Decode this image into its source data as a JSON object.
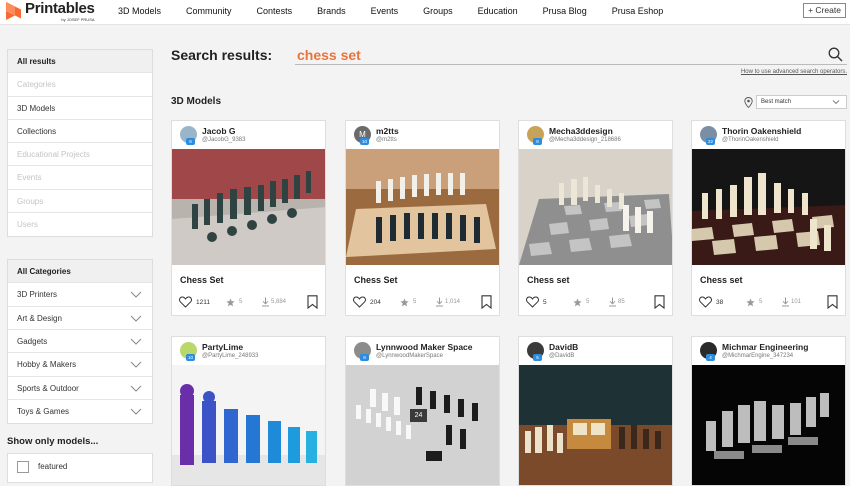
{
  "header": {
    "logo_name": "Printables",
    "logo_sub": "by JOSEF PRUSA",
    "nav": [
      "3D Models",
      "Community",
      "Contests",
      "Brands",
      "Events",
      "Groups",
      "Education",
      "Prusa Blog",
      "Prusa Eshop"
    ],
    "create_label": "+ Create"
  },
  "sidebar": {
    "results": [
      {
        "label": "All results",
        "state": "active"
      },
      {
        "label": "Categories",
        "state": "disabled"
      },
      {
        "label": "3D Models",
        "state": "normal"
      },
      {
        "label": "Collections",
        "state": "normal"
      },
      {
        "label": "Educational Projects",
        "state": "disabled"
      },
      {
        "label": "Events",
        "state": "disabled"
      },
      {
        "label": "Groups",
        "state": "disabled"
      },
      {
        "label": "Users",
        "state": "disabled"
      }
    ],
    "categories_title": "All Categories",
    "categories": [
      "3D Printers",
      "Art & Design",
      "Gadgets",
      "Hobby & Makers",
      "Sports & Outdoor",
      "Toys & Games"
    ],
    "show_only_title": "Show only models...",
    "featured_label": "featured"
  },
  "search": {
    "label": "Search results:",
    "query": "chess set",
    "advanced_link": "How to use advanced search operators."
  },
  "results": {
    "section_title": "3D Models",
    "sort_value": "Best match",
    "models": [
      {
        "author": "Jacob G",
        "handle": "@JacobG_9383",
        "level": "8",
        "avatar": "#9ab4c9",
        "title": "Chess Set",
        "likes": "1211",
        "rating": "5",
        "downloads": "5,884",
        "thumb": "glass"
      },
      {
        "author": "m2tts",
        "handle": "@m2tts",
        "level": "10",
        "avatar": "#6b6b6b",
        "avatar_letter": "M",
        "title": "Chess Set",
        "likes": "204",
        "rating": "5",
        "downloads": "1,014",
        "thumb": "wood"
      },
      {
        "author": "Mecha3ddesign",
        "handle": "@Mecha3ddesign_218686",
        "level": "8",
        "avatar": "#c7a35a",
        "title": "Chess set",
        "likes": "5",
        "rating": "5",
        "downloads": "85",
        "thumb": "grey"
      },
      {
        "author": "Thorin Oakenshield",
        "handle": "@ThorinOakenshield",
        "level": "22",
        "avatar": "#7a8fa3",
        "title": "Chess set",
        "likes": "38",
        "rating": "5",
        "downloads": "101",
        "thumb": "dark"
      },
      {
        "author": "PartyLime",
        "handle": "@PartyLime_248933",
        "level": "10",
        "avatar": "#b9d86a",
        "thumb": "blue"
      },
      {
        "author": "Lynnwood Maker Space",
        "handle": "@LynnwoodMakerSpace",
        "level": "8",
        "avatar": "#8c8c8c",
        "thumb": "bw",
        "image_count": "24"
      },
      {
        "author": "DavidB",
        "handle": "@DavidB",
        "level": "5",
        "avatar": "#3b3b3b",
        "thumb": "clock"
      },
      {
        "author": "Michmar Engineering",
        "handle": "@MichmarEngine_347234",
        "level": "4",
        "avatar": "#2a2a2a",
        "thumb": "black"
      }
    ]
  }
}
